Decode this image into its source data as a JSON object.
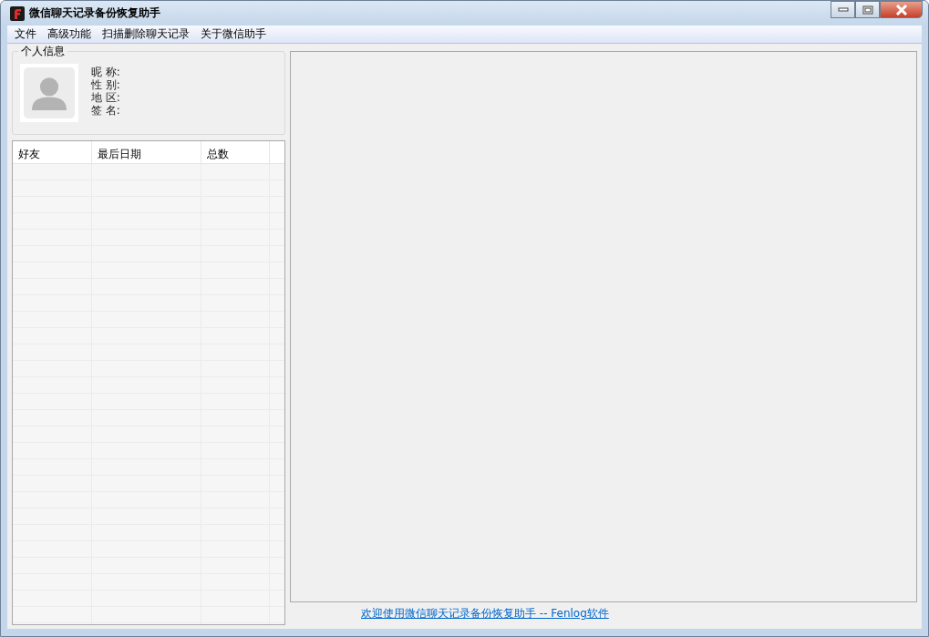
{
  "window": {
    "title": "微信聊天记录备份恢复助手"
  },
  "menu": [
    "文件",
    "高级功能",
    "扫描删除聊天记录",
    "关于微信助手"
  ],
  "profile": {
    "title": "个人信息",
    "fields": [
      "昵 称:",
      "性 别:",
      "地 区:",
      "签 名:"
    ]
  },
  "table": {
    "columns": [
      "好友",
      "最后日期",
      "总数"
    ]
  },
  "footer_link": "欢迎使用微信聊天记录备份恢复助手 -- Fenlog软件"
}
